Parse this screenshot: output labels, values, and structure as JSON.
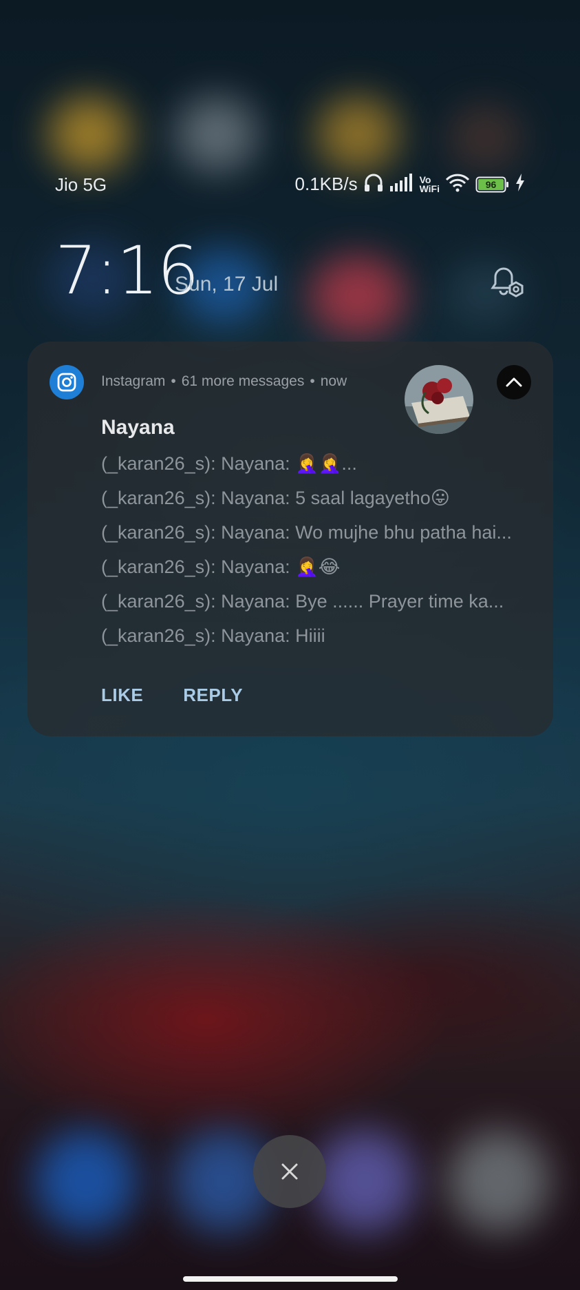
{
  "status_bar": {
    "carrier": "Jio 5G",
    "net_speed": "0.1KB/s",
    "volte_label_top": "Vo",
    "volte_label_bottom": "WiFi",
    "battery_level": "96",
    "icons": [
      "headphones-icon",
      "signal-icon",
      "vowifi-icon",
      "wifi-icon",
      "battery-icon",
      "charging-icon"
    ]
  },
  "lockscreen": {
    "time": "7:16",
    "date": "Sun, 17 Jul"
  },
  "notification": {
    "app_name": "Instagram",
    "more_messages": "61 more messages",
    "timestamp": "now",
    "sender": "Nayana",
    "messages": [
      "(_karan26_s): Nayana: 🤦‍♀️🤦‍♀️...",
      "(_karan26_s): Nayana: 5 saal lagayetho😛",
      "(_karan26_s): Nayana: Wo mujhe bhu patha hai...",
      "(_karan26_s): Nayana: 🤦‍♀️😂",
      "(_karan26_s): Nayana: Bye    ...... Prayer time ka...",
      "(_karan26_s): Nayana: Hiiii"
    ],
    "actions": {
      "like": "LIKE",
      "reply": "REPLY"
    }
  },
  "colors": {
    "accent_instagram": "#1f7fd6",
    "action_text": "#aacbe6",
    "battery_fill": "#6cc04a"
  }
}
